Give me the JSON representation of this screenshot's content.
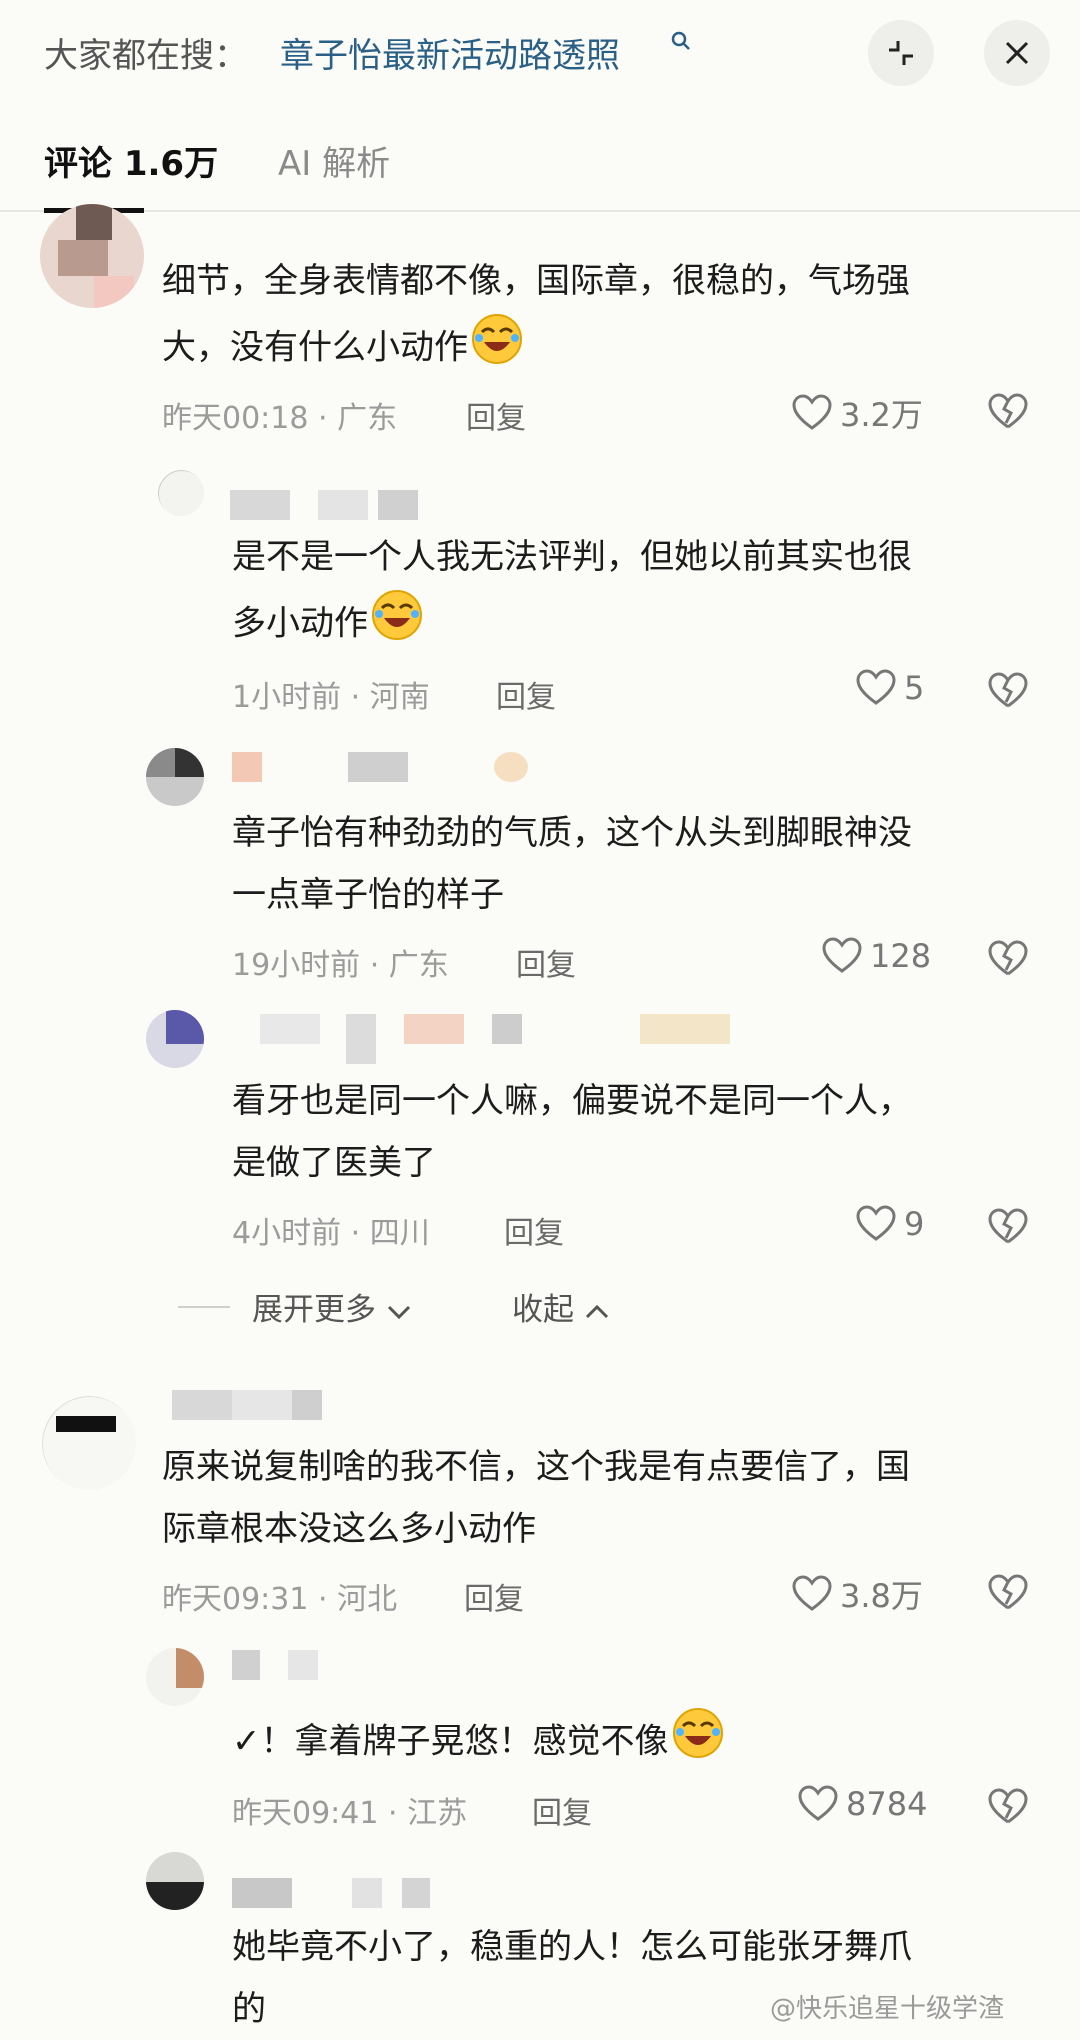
{
  "search": {
    "prefix": "大家都在搜：",
    "query": "章子怡最新活动路透照"
  },
  "tabs": {
    "comments": "评论 1.6万",
    "ai": "AI 解析"
  },
  "comments": [
    {
      "line1": "细节，全身表情都不像，国际章，很稳的，气场强",
      "line2": "大，没有什么小动作",
      "time": "昨天00:18",
      "location": "广东",
      "reply": "回复",
      "likes": "3.2万"
    },
    {
      "line1": "是不是一个人我无法评判，但她以前其实也很",
      "line2": "多小动作",
      "time": "1小时前",
      "location": "河南",
      "reply": "回复",
      "likes": "5"
    },
    {
      "line1": "章子怡有种劲劲的气质，这个从头到脚眼神没",
      "line2": "一点章子怡的样子",
      "time": "19小时前",
      "location": "广东",
      "reply": "回复",
      "likes": "128"
    },
    {
      "line1": "看牙也是同一个人嘛，偏要说不是同一个人，",
      "line2": "是做了医美了",
      "time": "4小时前",
      "location": "四川",
      "reply": "回复",
      "likes": "9"
    },
    {
      "line1": "原来说复制啥的我不信，这个我是有点要信了，国",
      "line2": "际章根本没这么多小动作",
      "time": "昨天09:31",
      "location": "河北",
      "reply": "回复",
      "likes": "3.8万"
    },
    {
      "line1": "✓！拿着牌子晃悠！感觉不像",
      "time": "昨天09:41",
      "location": "江苏",
      "reply": "回复",
      "likes": "8784"
    },
    {
      "line1": "她毕竟不小了，稳重的人！怎么可能张牙舞爪",
      "line2": "的"
    }
  ],
  "expand": {
    "more": "展开更多",
    "collapse": "收起"
  },
  "watermark": "@快乐追星十级学渣",
  "icons": {
    "search": "search-icon",
    "collapse": "collapse-icon",
    "close": "close-icon",
    "like": "heart-outline-icon",
    "dislike": "broken-heart-icon",
    "emoji": "laughing-crying-emoji"
  }
}
